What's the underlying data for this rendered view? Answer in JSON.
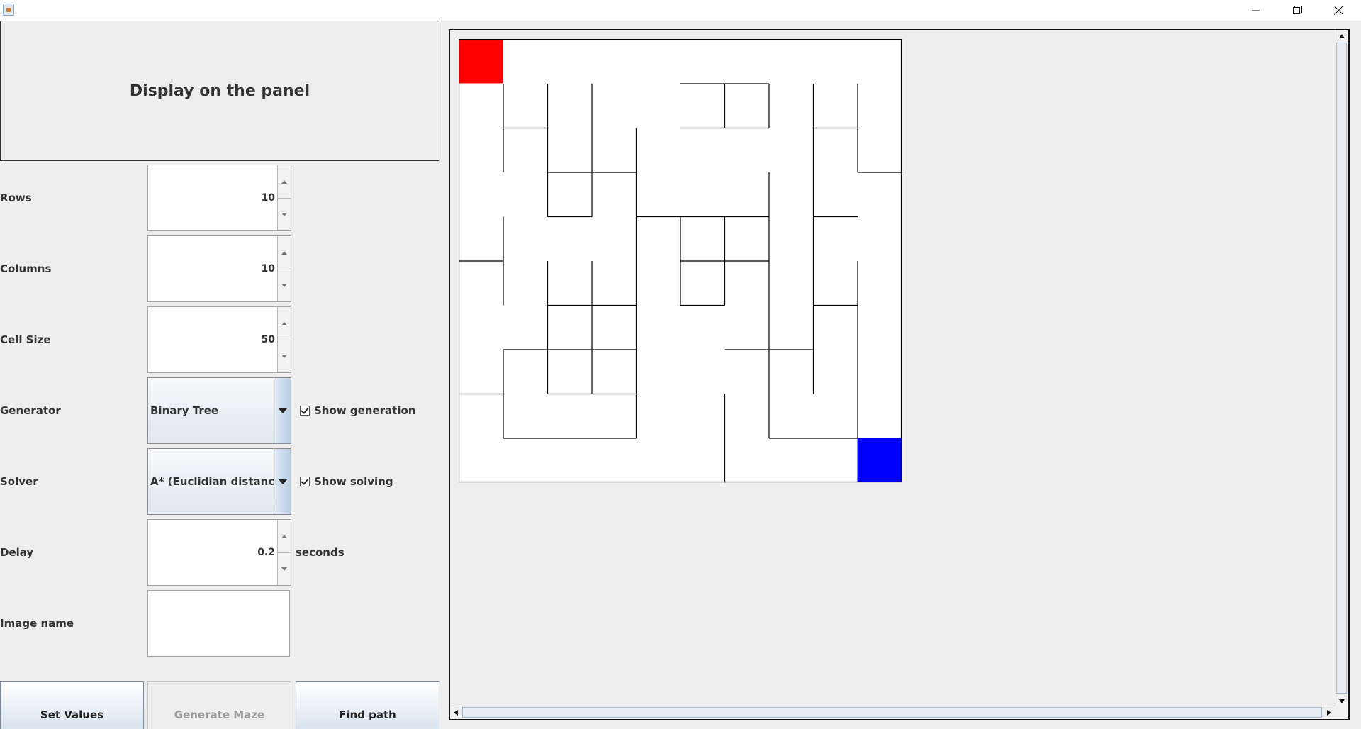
{
  "window": {
    "icon": "java-icon",
    "controls": [
      "minimize-icon",
      "restore-icon",
      "close-icon"
    ]
  },
  "left_panel": {
    "display_button": "Display on the panel",
    "rows": {
      "label": "Rows",
      "value": "10"
    },
    "columns": {
      "label": "Columns",
      "value": "10"
    },
    "cell_size": {
      "label": "Cell Size",
      "value": "50"
    },
    "generator": {
      "label": "Generator",
      "value": "Binary Tree",
      "checkbox_label": "Show generation",
      "checked": true
    },
    "solver": {
      "label": "Solver",
      "value": "A* (Euclidian distance)",
      "checkbox_label": "Show solving",
      "checked": true
    },
    "delay": {
      "label": "Delay",
      "value": "0.2",
      "units": "seconds"
    },
    "image_name": {
      "label": "Image name",
      "value": ""
    },
    "buttons": {
      "set_values": "Set Values",
      "generate_maze": "Generate Maze",
      "find_path": "Find path"
    }
  },
  "maze": {
    "rows": 10,
    "cols": 10,
    "start_cell": {
      "row": 0,
      "col": 0,
      "color": "#ff0000"
    },
    "end_cell": {
      "row": 9,
      "col": 9,
      "color": "#0000ff"
    },
    "wall_color": "#000000",
    "horizontal_walls": [
      [
        0,
        0,
        2
      ],
      [
        2,
        1,
        2
      ],
      [
        2,
        2,
        4
      ],
      [
        2,
        2,
        5
      ],
      [
        2,
        1,
        7
      ],
      [
        3,
        1,
        2
      ],
      [
        4,
        1,
        5
      ],
      [
        4,
        2,
        6
      ],
      [
        5,
        0,
        8
      ],
      [
        6,
        1,
        5
      ],
      [
        7,
        1,
        7
      ],
      [
        9,
        0,
        4
      ],
      [
        10,
        0,
        6
      ],
      [
        9,
        4,
        4
      ],
      [
        10,
        1,
        1
      ],
      [
        5,
        1,
        1
      ],
      [
        1,
        2,
        1
      ],
      [
        2,
        1,
        2
      ],
      [
        3,
        1,
        5
      ],
      [
        3,
        1,
        9
      ]
    ],
    "vertical_walls": [
      [
        1,
        1,
        3
      ],
      [
        2,
        1,
        3
      ],
      [
        3,
        1,
        3
      ],
      [
        4,
        2,
        7
      ],
      [
        6,
        1,
        1
      ],
      [
        7,
        1,
        1
      ],
      [
        8,
        1,
        2
      ],
      [
        9,
        1,
        3
      ],
      [
        1,
        4,
        5
      ],
      [
        2,
        5,
        8
      ],
      [
        3,
        5,
        8
      ],
      [
        5,
        4,
        6
      ],
      [
        6,
        4,
        6
      ],
      [
        7,
        2,
        8
      ],
      [
        8,
        4,
        8
      ],
      [
        9,
        5,
        9
      ],
      [
        1,
        7,
        9
      ],
      [
        4,
        8,
        10
      ],
      [
        6,
        8,
        10
      ]
    ]
  }
}
